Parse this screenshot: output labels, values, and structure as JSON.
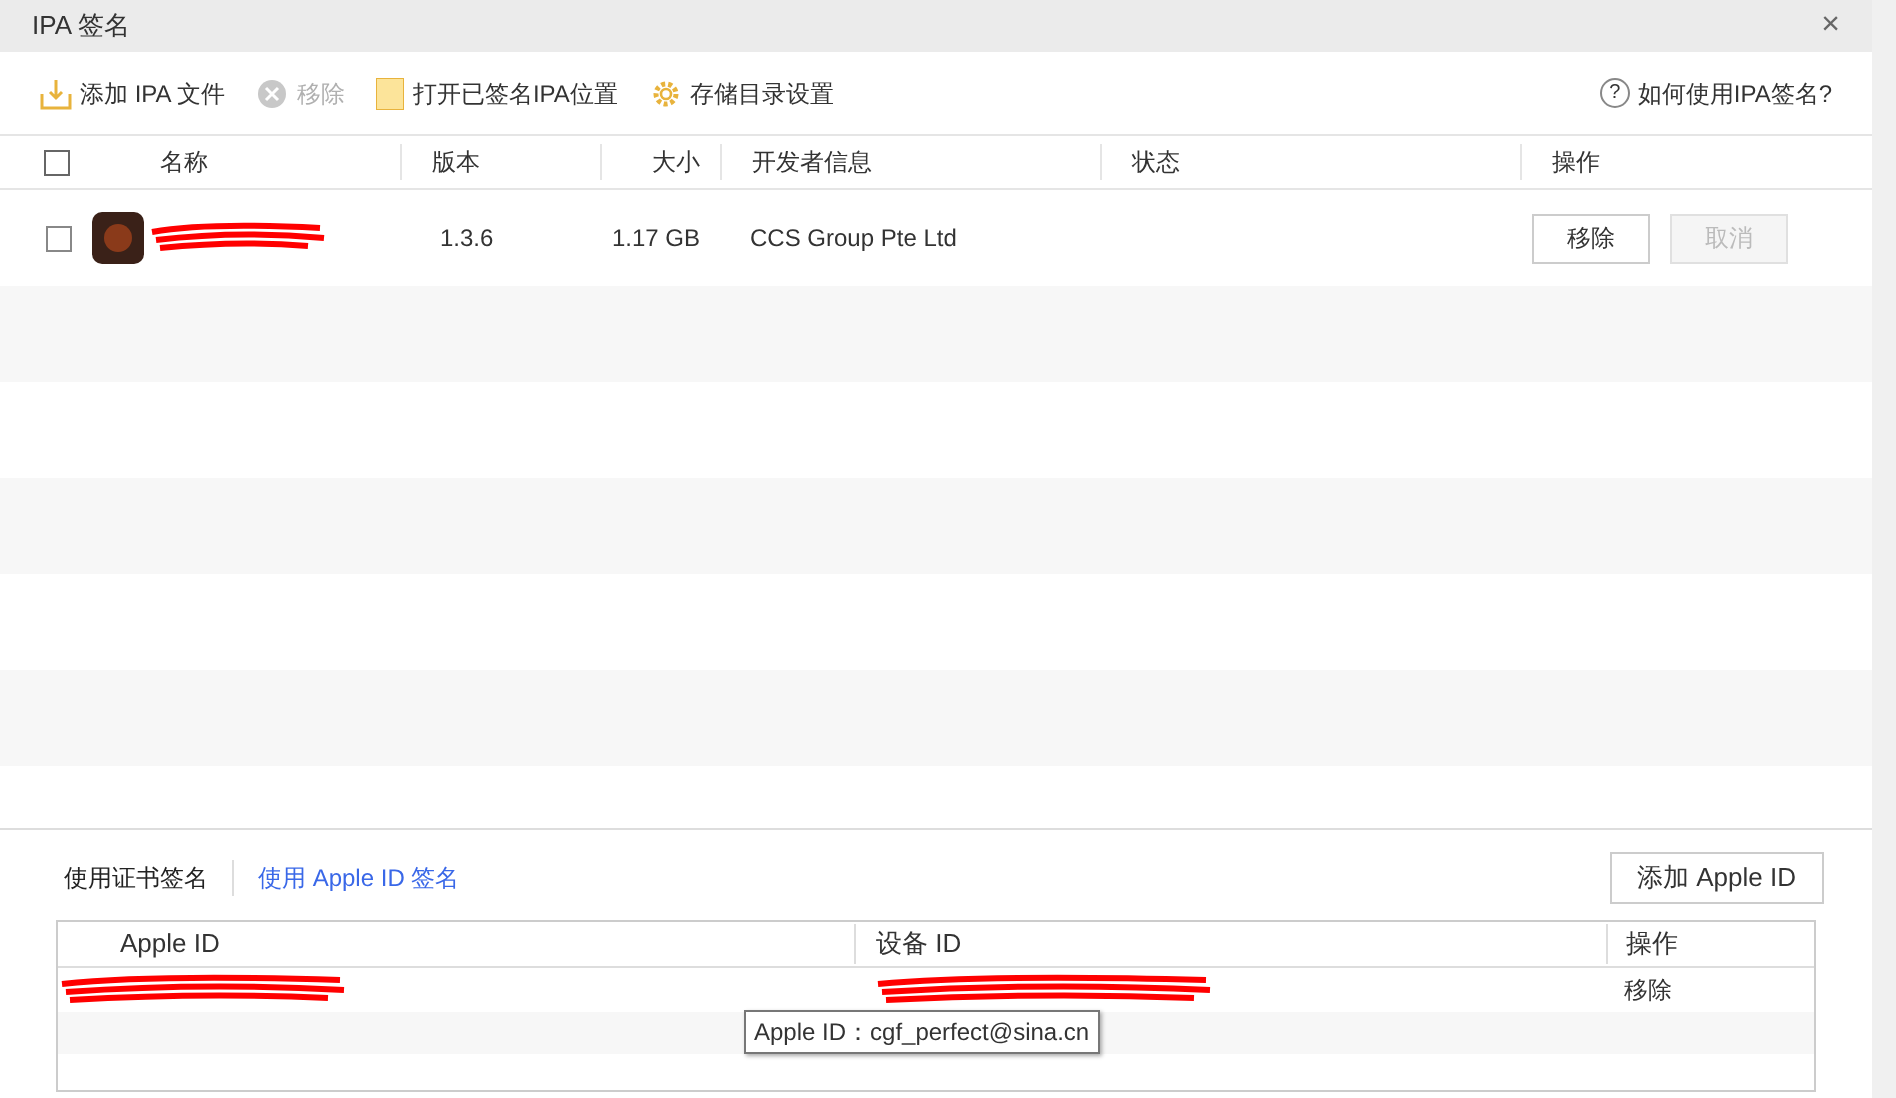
{
  "window": {
    "title": "IPA 签名",
    "close": "×"
  },
  "toolbar": [
    {
      "kind": "add",
      "label": "添加 IPA 文件",
      "disabled": false
    },
    {
      "kind": "remove",
      "label": "移除",
      "disabled": true
    },
    {
      "kind": "folder",
      "label": "打开已签名IPA位置",
      "disabled": false
    },
    {
      "kind": "gear",
      "label": "存储目录设置",
      "disabled": false
    }
  ],
  "help": {
    "icon": "?",
    "label": "如何使用IPA签名?"
  },
  "table": {
    "select_all": {
      "checked": false
    },
    "columns": [
      "名称",
      "版本",
      "大小",
      "开发者信息",
      "状态",
      "操作"
    ],
    "rows": [
      {
        "checked": false,
        "version": "1.3.6",
        "size": "1.17 GB",
        "developer": "CCS Group Pte Ltd",
        "actions": [
          {
            "label": "移除",
            "disabled": false
          },
          {
            "label": "取消",
            "disabled": true
          }
        ]
      }
    ]
  },
  "sign_tabs": [
    {
      "label": "使用证书签名",
      "selected": false
    },
    {
      "label": "使用 Apple ID 签名",
      "selected": true
    }
  ],
  "add_apple_id": "添加 Apple ID",
  "apple_table": {
    "columns": [
      "Apple ID",
      "设备 ID",
      "操作"
    ],
    "rows": [
      {
        "action": "移除"
      }
    ]
  },
  "tooltip": "Apple ID：cgf_perfect@sina.cn"
}
